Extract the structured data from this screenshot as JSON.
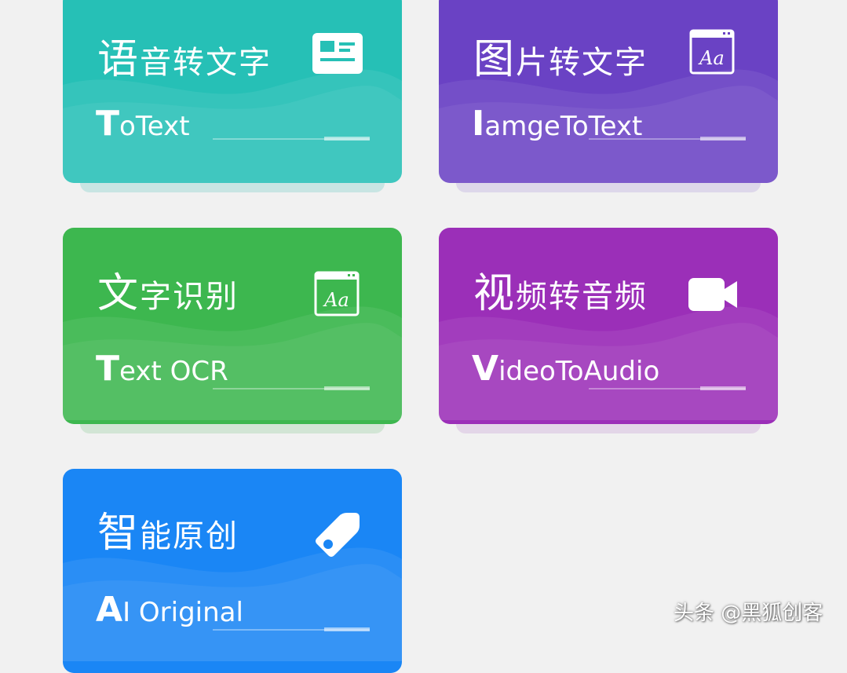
{
  "cards": [
    {
      "id": "voice-to-text",
      "title_lead": "语",
      "title_rest": "音转文字",
      "subtitle_lead": "T",
      "subtitle_rest": "oText",
      "color": "#26c0b6",
      "shadow": "#a6d8d4",
      "icon": "news-card-icon"
    },
    {
      "id": "image-to-text",
      "title_lead": "图",
      "title_rest": "片转文字",
      "subtitle_lead": "I",
      "subtitle_rest": "amgeToText",
      "color": "#6a42c4",
      "shadow": "#c9bde4",
      "icon": "font-window-icon"
    },
    {
      "id": "text-ocr",
      "title_lead": "文",
      "title_rest": "字识别",
      "subtitle_lead": "T",
      "subtitle_rest": "ext OCR",
      "color": "#3db74f",
      "shadow": "#b4dcba",
      "icon": "font-window-icon"
    },
    {
      "id": "video-to-audio",
      "title_lead": "视",
      "title_rest": "频转音频",
      "subtitle_lead": "V",
      "subtitle_rest": "ideoToAudio",
      "color": "#9b2fb8",
      "shadow": "#d8bde0",
      "icon": "video-camera-icon"
    },
    {
      "id": "ai-original",
      "title_lead": "智",
      "title_rest": "能原创",
      "subtitle_lead": "A",
      "subtitle_rest": "I Original",
      "color": "#1a86f5",
      "shadow": "#b3d4f5",
      "icon": "tag-icon"
    }
  ],
  "watermark": "头条 @黑狐创客"
}
